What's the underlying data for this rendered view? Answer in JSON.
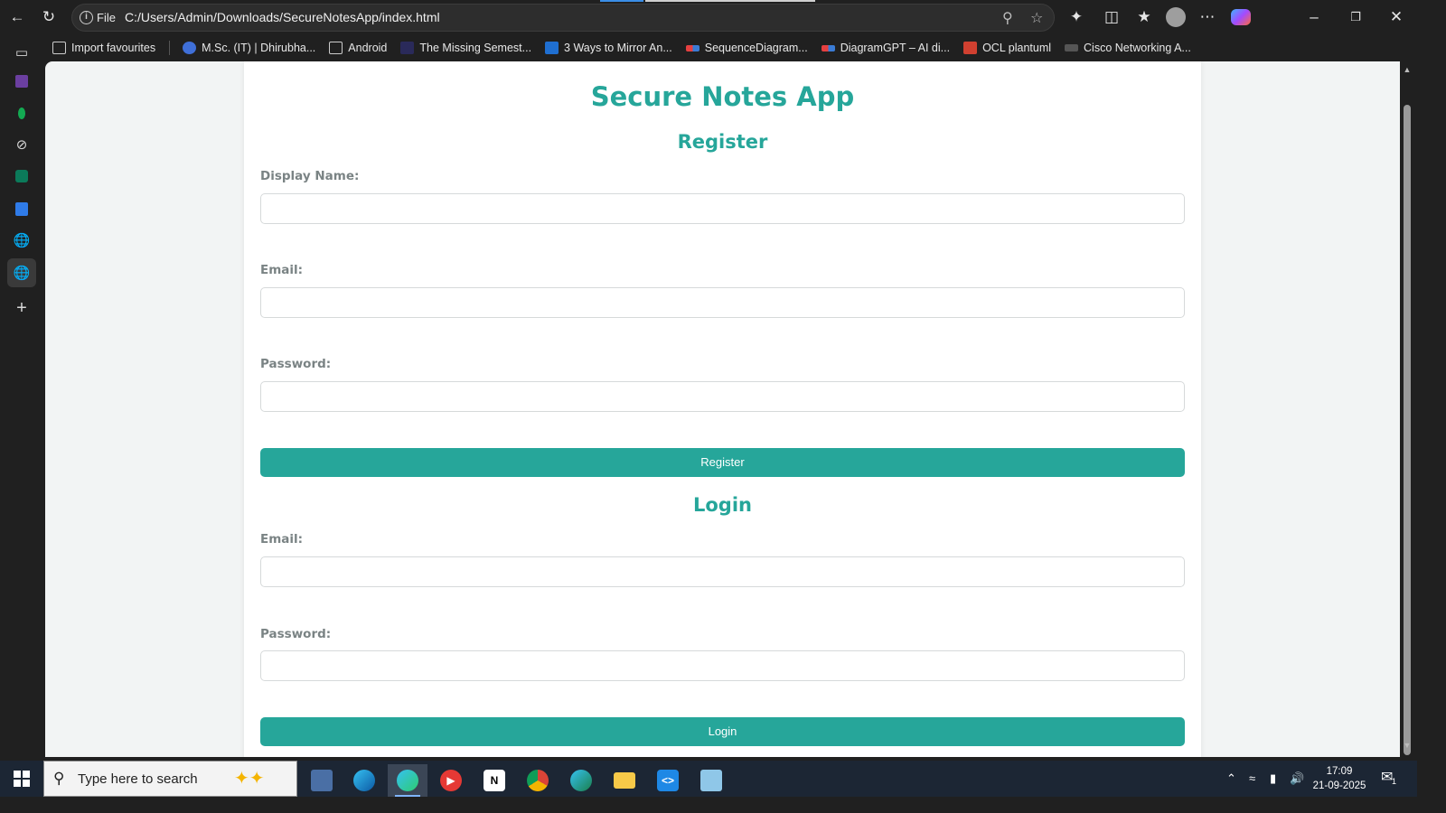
{
  "browser": {
    "url_scheme": "File",
    "url": "C:/Users/Admin/Downloads/SecureNotesApp/index.html"
  },
  "bookmarks": [
    {
      "label": "Import favourites",
      "icon": "import-icon",
      "color": "#cccccc"
    },
    {
      "label": "M.Sc. (IT) | Dhirubha...",
      "icon": "college-icon",
      "color": "#3f6fd8"
    },
    {
      "label": "Android",
      "icon": "folder-icon",
      "color": "#cccccc"
    },
    {
      "label": "The Missing Semest...",
      "icon": "terminal-icon",
      "color": "#2a2a5a"
    },
    {
      "label": "3 Ways to Mirror An...",
      "icon": "article-icon",
      "color": "#1f6fd1"
    },
    {
      "label": "SequenceDiagram...",
      "icon": "diagram-icon",
      "color": "#e64040"
    },
    {
      "label": "DiagramGPT – AI di...",
      "icon": "diagram-icon",
      "color": "#e64040"
    },
    {
      "label": "OCL plantuml",
      "icon": "plantuml-icon",
      "color": "#d04030"
    },
    {
      "label": "Cisco Networking A...",
      "icon": "cisco-icon",
      "color": "#888888"
    }
  ],
  "app": {
    "title": "Secure Notes App",
    "register": {
      "heading": "Register",
      "display_name_label": "Display Name:",
      "email_label": "Email:",
      "password_label": "Password:",
      "button_label": "Register"
    },
    "login": {
      "heading": "Login",
      "email_label": "Email:",
      "password_label": "Password:",
      "button_label": "Login"
    }
  },
  "taskbar": {
    "search_placeholder": "Type here to search",
    "time": "17:09",
    "date": "21-09-2025",
    "notification_count": "1"
  },
  "colors": {
    "accent": "#26a69a",
    "label": "#7a8384"
  }
}
